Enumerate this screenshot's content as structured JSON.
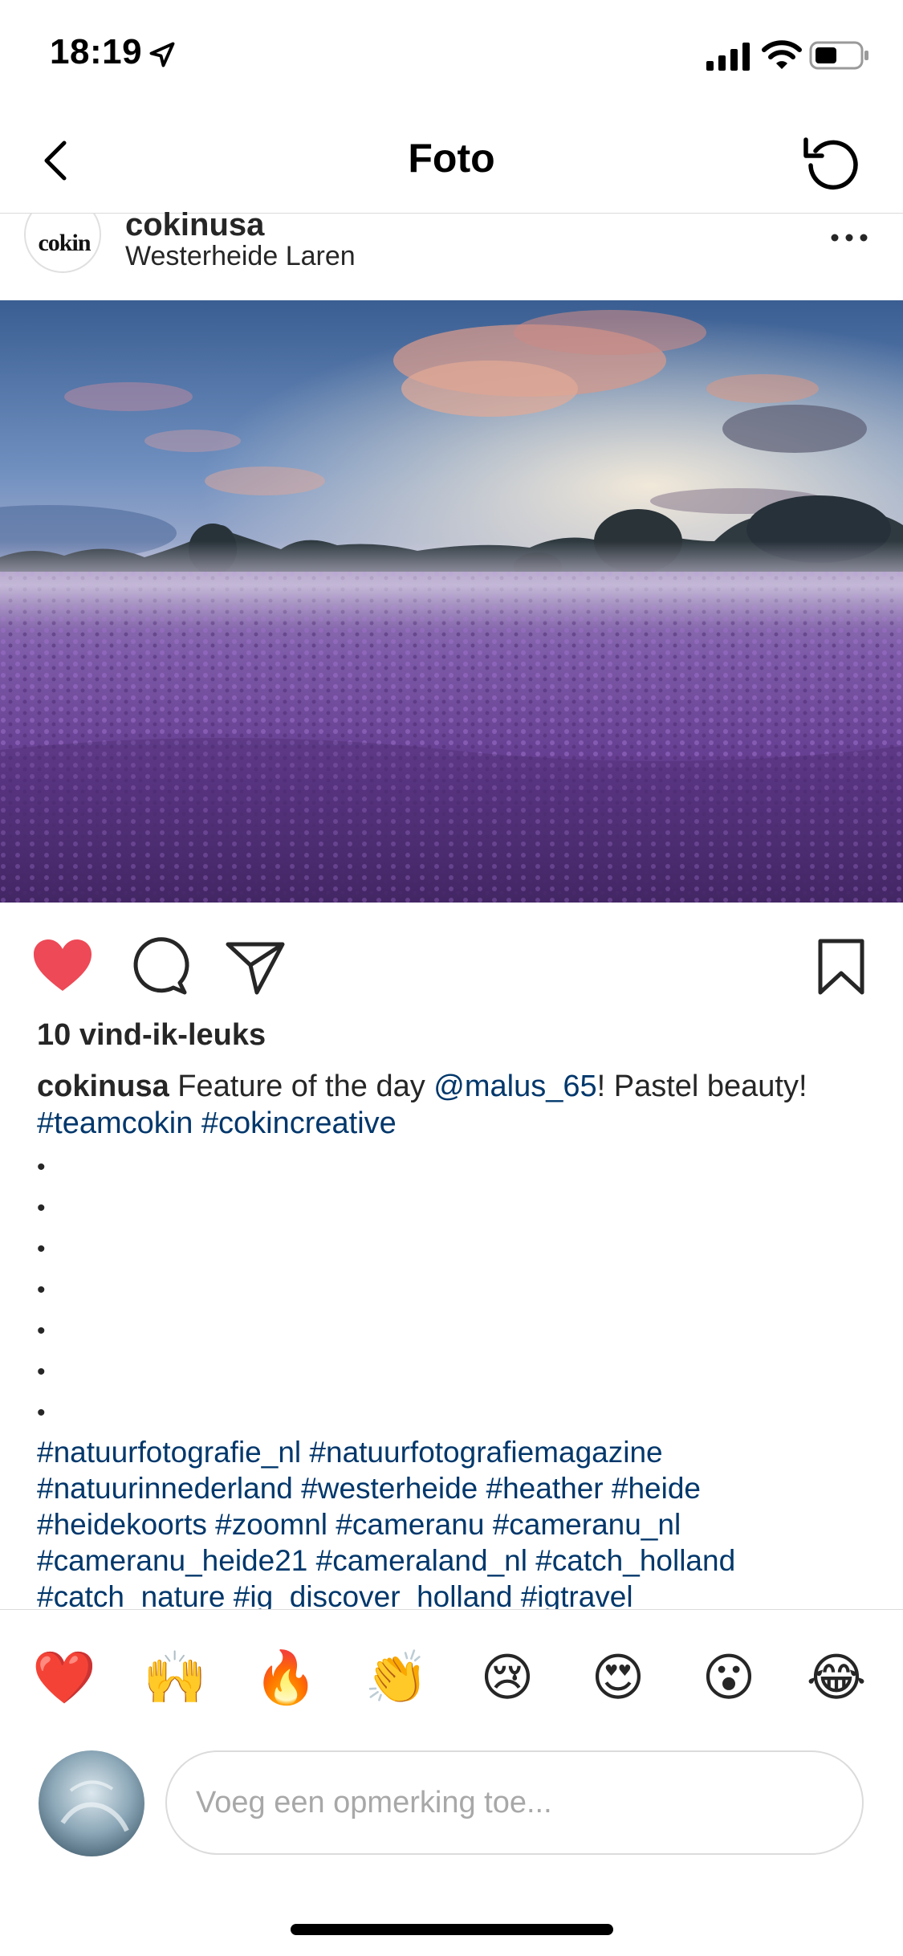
{
  "status_bar": {
    "time": "18:19"
  },
  "nav": {
    "title": "Foto"
  },
  "post": {
    "username": "cokinusa",
    "location": "Westerheide Laren",
    "avatar_text": "cokin",
    "likes": "10 vind-ik-leuks",
    "caption": {
      "user": "cokinusa",
      "text_before": " Feature of the day ",
      "mention": "@malus_65",
      "text_after": "! Pastel beauty!",
      "tag_1": "#teamcokin",
      "tag_2": "#cokincreative"
    },
    "dots": [
      "•",
      "•",
      "•",
      "•",
      "•",
      "•",
      "•"
    ],
    "hashtags": [
      "#natuurfotografie_nl",
      "#natuurfotografiemagazine",
      "#natuurinnederland",
      "#westerheide",
      "#heather",
      "#heide",
      "#heidekoorts",
      "#zoomnl",
      "#cameranu",
      "#cameranu_nl",
      "#cameranu_heide21",
      "#cameraland_nl",
      "#catch_holland",
      "#catch_nature",
      "#ig_discover_holland",
      "#igtravel"
    ]
  },
  "reactions": [
    {
      "emoji": "❤️",
      "name": "heart"
    },
    {
      "emoji": "🙌",
      "name": "raising-hands"
    },
    {
      "emoji": "🔥",
      "name": "fire"
    },
    {
      "emoji": "👏",
      "name": "clapping-hands"
    },
    {
      "emoji": "😢",
      "name": "crying-face"
    },
    {
      "emoji": "😍",
      "name": "heart-eyes"
    },
    {
      "emoji": "😮",
      "name": "surprised-face"
    },
    {
      "emoji": "😂",
      "name": "tears-of-joy"
    }
  ],
  "comment": {
    "placeholder": "Voeg een opmerking toe...",
    "value": ""
  },
  "colors": {
    "like": "#ed4956",
    "link": "#00376b",
    "heather": "#7a4a9e"
  },
  "icons": {
    "back": "chevron-left-icon",
    "refresh": "refresh-icon",
    "more": "more-horizontal-icon",
    "like": "heart-filled-icon",
    "comment": "comment-icon",
    "share": "paper-plane-icon",
    "save": "bookmark-icon"
  }
}
